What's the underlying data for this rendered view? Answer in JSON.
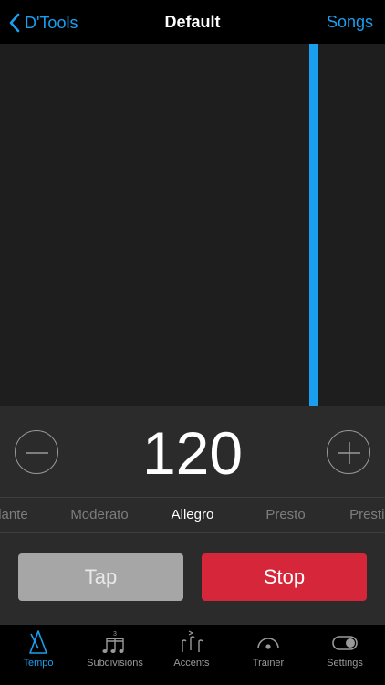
{
  "nav": {
    "back_label": "D'Tools",
    "title": "Default",
    "right_label": "Songs"
  },
  "bpm": "120",
  "tempo_markings": [
    "dante",
    "Moderato",
    "Allegro",
    "Presto",
    "Prestis"
  ],
  "active_tempo": "Allegro",
  "buttons": {
    "tap": "Tap",
    "stop": "Stop"
  },
  "tabs": [
    {
      "label": "Tempo",
      "icon": "metronome-icon",
      "active": true
    },
    {
      "label": "Subdivisions",
      "icon": "triplet-notes-icon",
      "active": false
    },
    {
      "label": "Accents",
      "icon": "accent-notes-icon",
      "active": false
    },
    {
      "label": "Trainer",
      "icon": "gauge-icon",
      "active": false
    },
    {
      "label": "Settings",
      "icon": "toggle-icon",
      "active": false
    }
  ],
  "colors": {
    "accent": "#1a9ff0",
    "stop": "#d6263a",
    "tap": "#a6a6a6"
  }
}
